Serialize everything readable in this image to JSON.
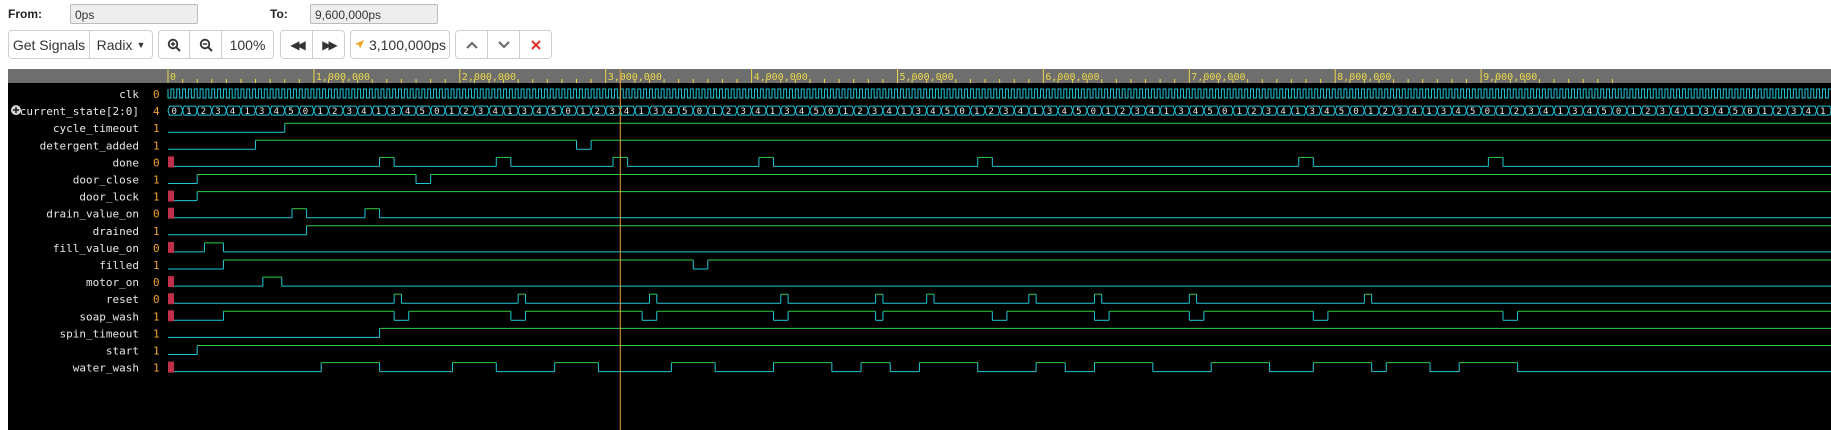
{
  "range": {
    "from_label": "From:",
    "from_value": "0ps",
    "to_label": "To:",
    "to_value": "9,600,000ps"
  },
  "toolbar": {
    "get_signals": "Get Signals",
    "radix": "Radix",
    "zoom_level": "100%",
    "cursor_time": "3,100,000ps"
  },
  "timeline": {
    "ticks": [
      "0",
      "1,000,000",
      "2,000,000",
      "3,000,000",
      "4,000,000",
      "5,000,000",
      "6,000,000",
      "7,000,000",
      "8,000,000",
      "9,000,000"
    ],
    "cursor_ps": 3100000
  },
  "signals": [
    {
      "name": "clk",
      "value": "0"
    },
    {
      "name": "current_state[2:0]",
      "value": "4"
    },
    {
      "name": "cycle_timeout",
      "value": "1"
    },
    {
      "name": "detergent_added",
      "value": "1"
    },
    {
      "name": "done",
      "value": "0"
    },
    {
      "name": "door_close",
      "value": "1"
    },
    {
      "name": "door_lock",
      "value": "1"
    },
    {
      "name": "drain_value_on",
      "value": "0"
    },
    {
      "name": "drained",
      "value": "1"
    },
    {
      "name": "fill_value_on",
      "value": "0"
    },
    {
      "name": "filled",
      "value": "1"
    },
    {
      "name": "motor_on",
      "value": "0"
    },
    {
      "name": "reset",
      "value": "0"
    },
    {
      "name": "soap_wash",
      "value": "1"
    },
    {
      "name": "spin_timeout",
      "value": "1"
    },
    {
      "name": "start",
      "value": "1"
    },
    {
      "name": "water_wash",
      "value": "1"
    }
  ],
  "colors": {
    "waveform_high": "#2ecc40",
    "waveform_low": "#1fc8d8",
    "value_text": "#f0a030",
    "timeline_text": "#e8d84a",
    "cursor": "#e8a040",
    "unknown_marker": "#c0304a",
    "panel_background": "#000000",
    "timeline_background": "#6e6e6e"
  },
  "icons": {
    "expand": "plus-circle-icon",
    "zoom_in": "zoom-in-icon",
    "zoom_out": "zoom-out-icon",
    "prev": "double-chevron-left-icon",
    "next": "double-chevron-right-icon",
    "cursor": "cursor-arrow-icon",
    "up": "chevron-up-icon",
    "down": "chevron-down-icon",
    "clear": "close-icon"
  }
}
